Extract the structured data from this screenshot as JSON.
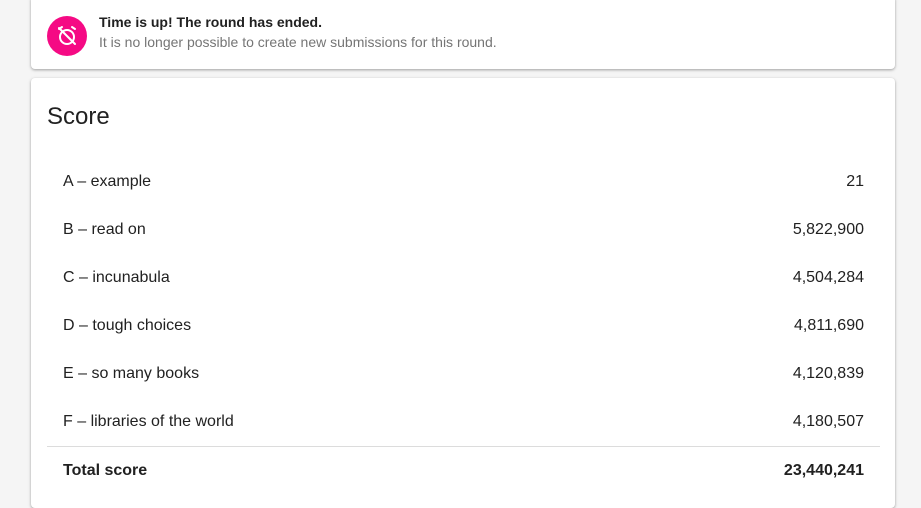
{
  "alert": {
    "icon": "alarm-off-icon",
    "icon_color": "#f50a84",
    "title": "Time is up! The round has ended.",
    "message": "It is no longer possible to create new submissions for this round."
  },
  "score": {
    "title": "Score",
    "rows": [
      {
        "label": "A – example",
        "value": "21"
      },
      {
        "label": "B – read on",
        "value": "5,822,900"
      },
      {
        "label": "C – incunabula",
        "value": "4,504,284"
      },
      {
        "label": "D – tough choices",
        "value": "4,811,690"
      },
      {
        "label": "E – so many books",
        "value": "4,120,839"
      },
      {
        "label": "F – libraries of the world",
        "value": "4,180,507"
      }
    ],
    "total_label": "Total score",
    "total_value": "23,440,241"
  }
}
